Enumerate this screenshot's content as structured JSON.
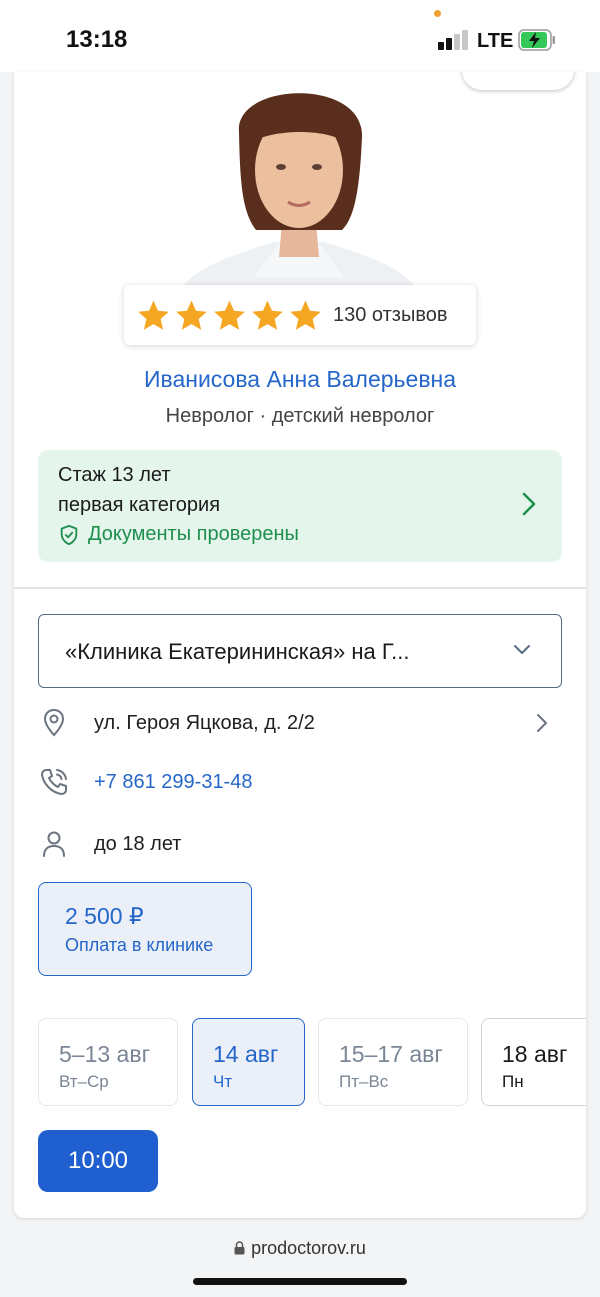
{
  "status_bar": {
    "time": "13:18",
    "network": "LTE",
    "icons": [
      "signal-icon",
      "battery-charging-icon"
    ]
  },
  "doctor": {
    "rating_stars": 5,
    "reviews": "130 отзывов",
    "name": "Иванисова Анна Валерьевна",
    "specialty": "Невролог · детский невролог"
  },
  "experience": {
    "years": "Стаж 13 лет",
    "category": "первая категория",
    "verified": "Документы проверены"
  },
  "clinic": {
    "selected": "«Клиника Екатерининская» на Г..."
  },
  "info": {
    "address": "ул. Героя Яцкова, д. 2/2",
    "phone": "+7 861 299-31-48",
    "age": "до 18 лет"
  },
  "price": {
    "value": "2 500 ₽",
    "note": "Оплата в клинике"
  },
  "dates": [
    {
      "date": "5–13 авг",
      "days": "Вт–Ср",
      "state": "unavailable"
    },
    {
      "date": "14 авг",
      "days": "Чт",
      "state": "selected"
    },
    {
      "date": "15–17 авг",
      "days": "Пт–Вс",
      "state": "unavailable"
    },
    {
      "date": "18 авг",
      "days": "Пн",
      "state": "available"
    }
  ],
  "time_slots": [
    "10:00"
  ],
  "browser": {
    "url": "prodoctorov.ru"
  },
  "colors": {
    "accent": "#2566c9",
    "success": "#1f8f4e",
    "success_bg": "#e4f5ec",
    "star": "#f5a623",
    "button": "#1f5fcf"
  }
}
